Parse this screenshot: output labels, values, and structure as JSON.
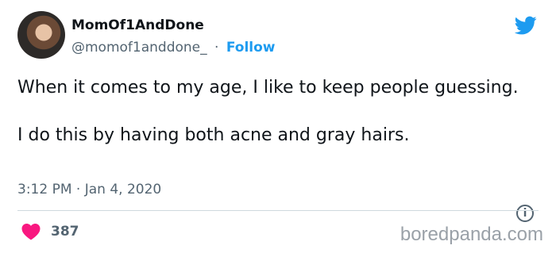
{
  "author": {
    "display_name": "MomOf1AndDone",
    "handle": "@momof1anddone_",
    "separator": "·",
    "follow_label": "Follow"
  },
  "tweet": {
    "paragraphs": [
      "When it comes to my age, I like to keep people guessing.",
      "I do this by having both acne and gray hairs."
    ],
    "timestamp": "3:12 PM · Jan 4, 2020",
    "like_count": "387"
  },
  "watermark": "boredpanda.com",
  "icons": {
    "brand": "twitter-bird-icon",
    "info": "info-icon",
    "like": "heart-icon"
  },
  "colors": {
    "accent": "#1d9bf0",
    "like": "#f91880",
    "text": "#0f1419",
    "muted": "#536471"
  }
}
